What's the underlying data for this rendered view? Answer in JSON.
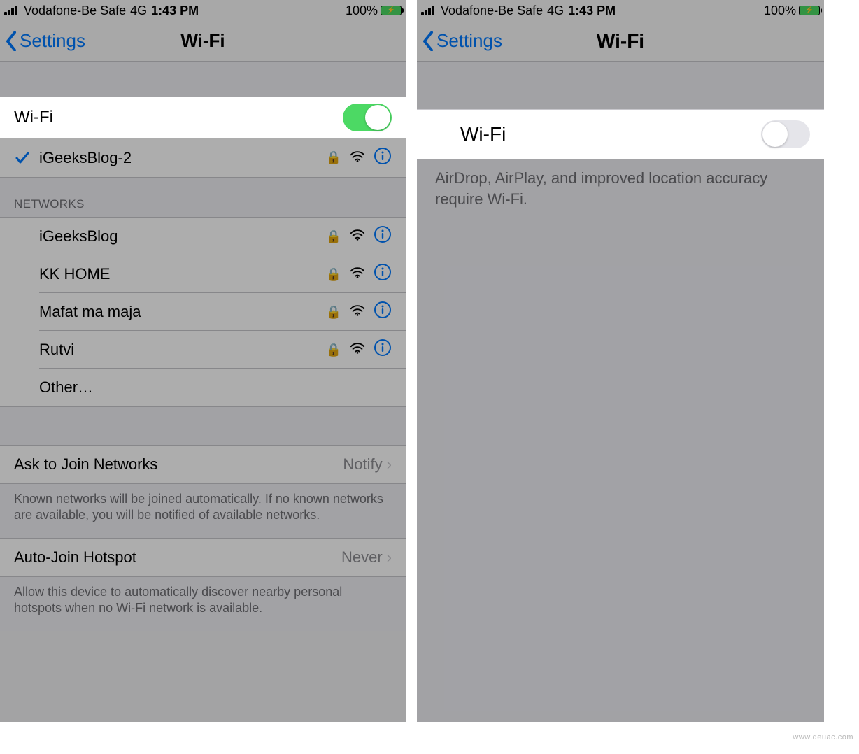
{
  "watermark": "www.deuac.com",
  "left": {
    "status": {
      "carrier": "Vodafone-Be Safe",
      "conn": "4G",
      "time": "1:43 PM",
      "battery_pct": "100%"
    },
    "nav": {
      "back": "Settings",
      "title": "Wi-Fi"
    },
    "wifi_toggle_label": "Wi-Fi",
    "wifi_toggle_on": true,
    "connected_network": "iGeeksBlog-2",
    "networks_header": "NETWORKS",
    "networks": [
      {
        "name": "iGeeksBlog",
        "locked": true
      },
      {
        "name": "KK HOME",
        "locked": true
      },
      {
        "name": "Mafat ma maja",
        "locked": true
      },
      {
        "name": "Rutvi",
        "locked": true
      }
    ],
    "other_label": "Other…",
    "ask_join": {
      "label": "Ask to Join Networks",
      "value": "Notify",
      "footer": "Known networks will be joined automatically. If no known networks are available, you will be notified of available networks."
    },
    "auto_hotspot": {
      "label": "Auto-Join Hotspot",
      "value": "Never",
      "footer": "Allow this device to automatically discover nearby personal hotspots when no Wi-Fi network is available."
    }
  },
  "right": {
    "status": {
      "carrier": "Vodafone-Be Safe",
      "conn": "4G",
      "time": "1:43 PM",
      "battery_pct": "100%"
    },
    "nav": {
      "back": "Settings",
      "title": "Wi-Fi"
    },
    "wifi_toggle_label": "Wi-Fi",
    "wifi_toggle_on": false,
    "info_text": "AirDrop, AirPlay, and improved location accuracy require Wi-Fi."
  }
}
